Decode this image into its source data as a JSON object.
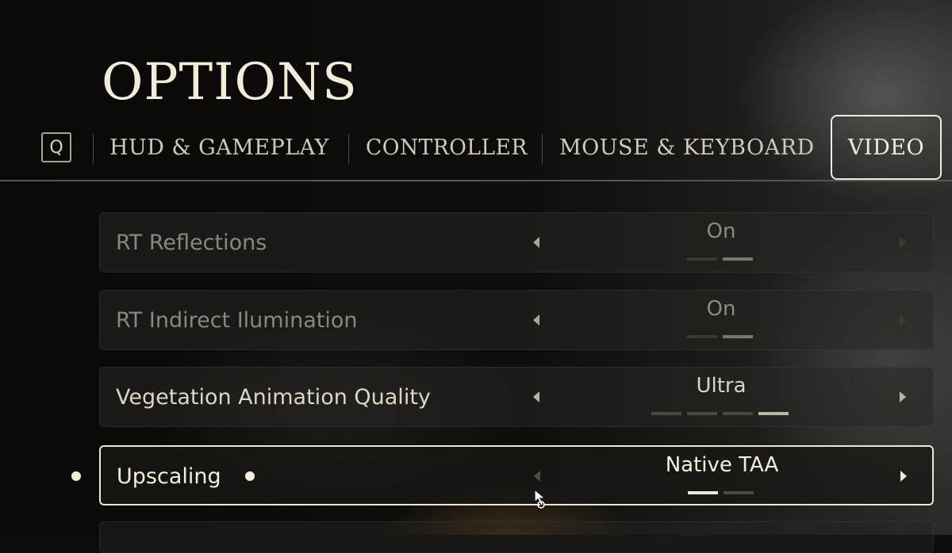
{
  "title": "OPTIONS",
  "tabs": {
    "key_hint": "Q",
    "items": [
      {
        "label": "HUD & GAMEPLAY"
      },
      {
        "label": "CONTROLLER"
      },
      {
        "label": "MOUSE & KEYBOARD"
      },
      {
        "label": "VIDEO"
      }
    ],
    "active": "VIDEO"
  },
  "settings": [
    {
      "label": "RT Reflections",
      "value": "On",
      "steps": 2,
      "selected_step": 2
    },
    {
      "label": "RT Indirect Ilumination",
      "value": "On",
      "steps": 2,
      "selected_step": 2
    },
    {
      "label": "Vegetation Animation Quality",
      "value": "Ultra",
      "steps": 4,
      "selected_step": 4
    },
    {
      "label": "Upscaling",
      "value": "Native TAA",
      "steps": 2,
      "selected_step": 1
    }
  ],
  "colors": {
    "text": "#f3ecd8",
    "highlight_border": "#ece6d6",
    "background": "#0d0c0a"
  }
}
